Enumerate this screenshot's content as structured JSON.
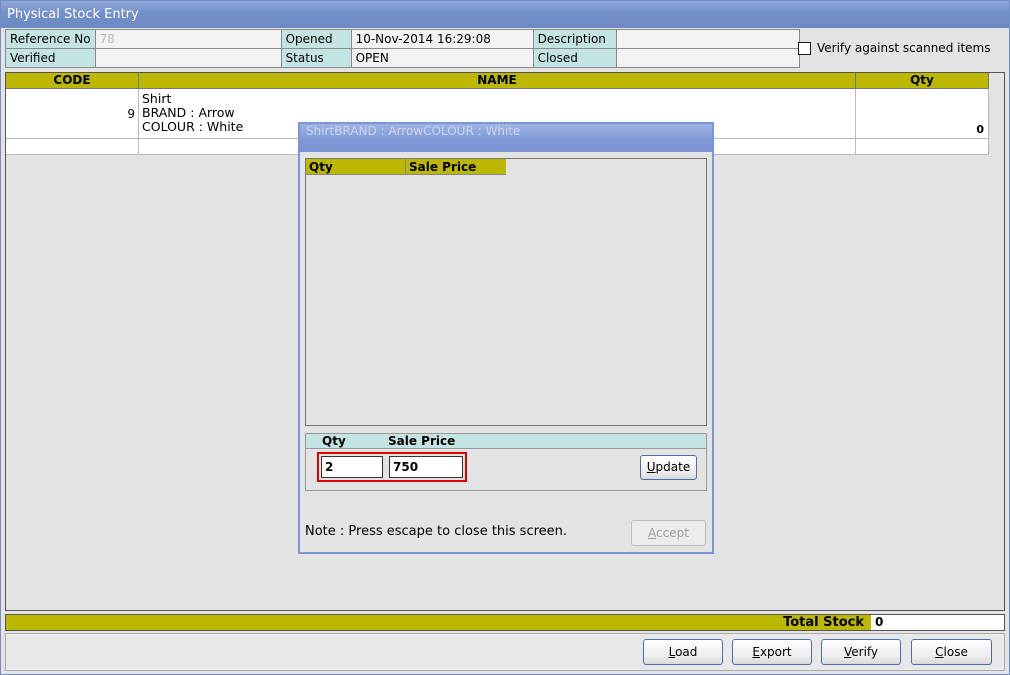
{
  "window": {
    "title": "Physical Stock Entry"
  },
  "header": {
    "reference_no_label": "Reference No",
    "reference_no_value": "78",
    "opened_label": "Opened",
    "opened_value": "10-Nov-2014 16:29:08",
    "description_label": "Description",
    "description_value": "",
    "verified_label": "Verified",
    "verified_value": "",
    "status_label": "Status",
    "status_value": "OPEN",
    "closed_label": "Closed",
    "closed_value": ""
  },
  "verify_checkbox": {
    "label": "Verify against scanned items",
    "checked": false
  },
  "grid": {
    "columns": [
      "CODE",
      "NAME",
      "Qty"
    ],
    "rows": [
      {
        "code": "9",
        "name_lines": [
          "Shirt",
          "BRAND : Arrow",
          "COLOUR : White"
        ],
        "qty": "0"
      }
    ]
  },
  "dialog": {
    "title": "ShirtBRAND : ArrowCOLOUR : White",
    "list_columns": [
      "Qty",
      "Sale Price"
    ],
    "entry_labels": {
      "qty": "Qty",
      "sale_price": "Sale Price"
    },
    "qty_value": "2",
    "sale_price_value": "750",
    "update_label": "Update",
    "note": "Note : Press escape to close this screen.",
    "accept_label": "Accept"
  },
  "total": {
    "label": "Total Stock",
    "value": "0"
  },
  "buttons": {
    "load": "Load",
    "export": "Export",
    "verify": "Verify",
    "close": "Close"
  },
  "colors": {
    "accent_olive": "#bcb701",
    "label_teal": "#c4e4e3",
    "highlight_red": "#e00000"
  }
}
